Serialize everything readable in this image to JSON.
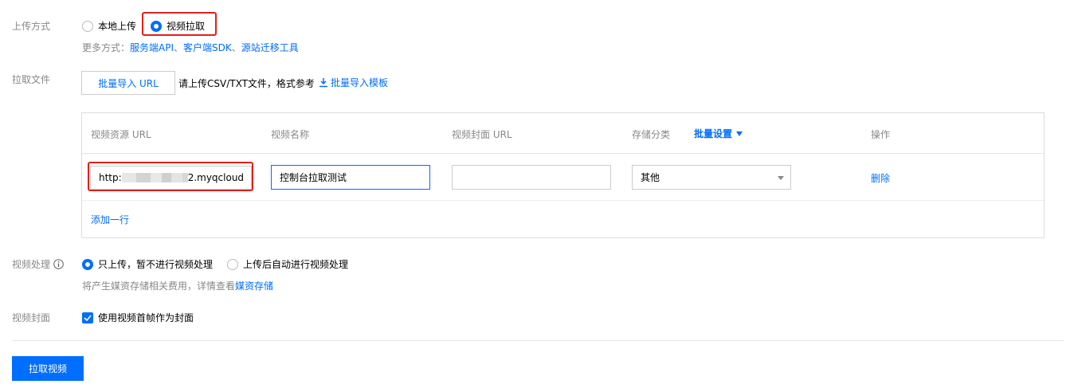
{
  "upload_method": {
    "label": "上传方式",
    "options": [
      "本地上传",
      "视频拉取"
    ],
    "selected": "视频拉取",
    "more_prefix": "更多方式：",
    "more_links": [
      "服务端API",
      "客户端SDK",
      "源站迁移工具"
    ],
    "separator": "、"
  },
  "pull_file": {
    "label": "拉取文件",
    "import_button": "批量导入 URL",
    "hint": "请上传CSV/TXT文件，格式参考",
    "template_link": "批量导入模板"
  },
  "table": {
    "headers": {
      "url": "视频资源 URL",
      "name": "视频名称",
      "cover": "视频封面 URL",
      "category": "存储分类",
      "batch": "批量设置",
      "ops": "操作"
    },
    "row": {
      "url_start": "http:",
      "url_end": "2.myqcloud",
      "name": "控制台拉取测试",
      "cover": "",
      "category": "其他",
      "delete": "删除"
    },
    "add_row": "添加一行"
  },
  "processing": {
    "label": "视频处理",
    "options": [
      "只上传，暂不进行视频处理",
      "上传后自动进行视频处理"
    ],
    "selected": "只上传，暂不进行视频处理",
    "note_prefix": "将产生媒资存储相关费用，详情查看",
    "note_link": "媒资存储"
  },
  "cover": {
    "label": "视频封面",
    "checkbox_label": "使用视频首帧作为封面",
    "checked": true
  },
  "submit": "拉取视频",
  "colors": {
    "accent": "#006eff",
    "highlight": "#e0201b"
  }
}
